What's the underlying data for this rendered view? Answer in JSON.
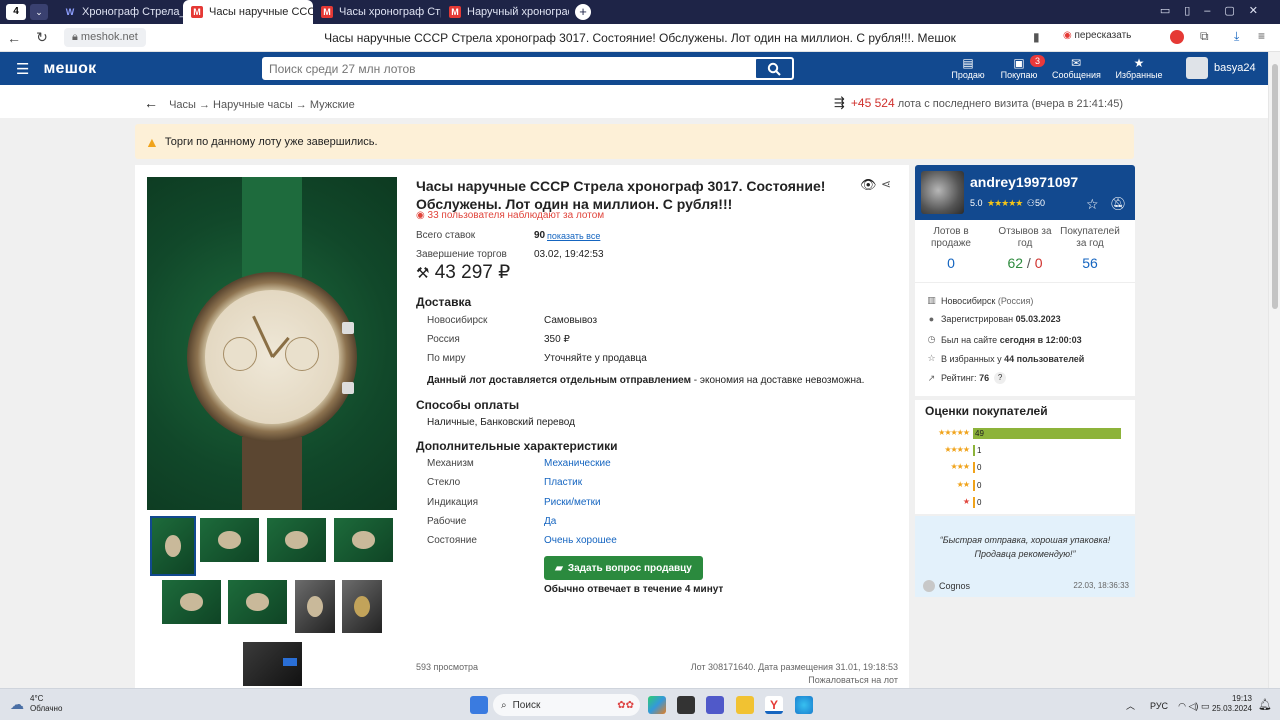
{
  "browser": {
    "tab_counter": "4",
    "tabs": [
      {
        "label": "Хронограф Стрела_ оцен",
        "favicon": "W"
      },
      {
        "label": "Часы наручные СССР С",
        "favicon": "M"
      },
      {
        "label": "Часы хронограф Стрела",
        "favicon": "M"
      },
      {
        "label": "Наручный хронограф - С",
        "favicon": "M"
      }
    ],
    "url": "meshok.net",
    "page_title": "Часы наручные СССР Стрела хронограф 3017. Состояние! Обслужены. Лот один на миллион. С рубля!!!. Мешок",
    "retell_label": "пересказать"
  },
  "site": {
    "logo": "мешок",
    "search_placeholder": "Поиск среди 27 млн лотов",
    "nav": [
      {
        "label": "Продаю",
        "icon": "store-icon"
      },
      {
        "label": "Покупаю",
        "icon": "bag-icon",
        "badge": "3"
      },
      {
        "label": "Сообщения",
        "icon": "mail-icon"
      },
      {
        "label": "Избранные",
        "icon": "star-icon"
      }
    ],
    "username": "basya24"
  },
  "breadcrumb": {
    "path": "Часы → Наручные часы → Мужские",
    "new_count": "+45 524",
    "new_text": "лота с последнего визита (вчера в 21:41:45)"
  },
  "warning": "Торги по данному лоту уже завершились.",
  "lot": {
    "title": "Часы наручные СССР Стрела хронограф 3017. Состояние! Обслужены. Лот один на миллион. С рубля!!!",
    "watchers": "33 пользователя наблюдают за лотом",
    "bids_label": "Всего ставок",
    "bids_value": "90",
    "bids_link": "показать все",
    "end_label": "Завершение торгов",
    "end_value": "03.02, 19:42:53",
    "price": "43 297 ₽",
    "delivery_title": "Доставка",
    "delivery": [
      {
        "where": "Новосибирск",
        "value": "Самовывоз"
      },
      {
        "where": "Россия",
        "value": "350 ₽"
      },
      {
        "where": "По миру",
        "value": "Уточняйте у продавца"
      }
    ],
    "delivery_note_bold": "Данный лот доставляется отдельным отправлением",
    "delivery_note_rest": " - экономия на доставке невозможна.",
    "payment_title": "Способы оплаты",
    "payment": "Наличные, Банковский перевод",
    "extra_title": "Дополнительные характеристики",
    "extra": [
      {
        "key": "Механизм",
        "value": "Механические"
      },
      {
        "key": "Стекло",
        "value": "Пластик"
      },
      {
        "key": "Индикация",
        "value": "Риски/метки"
      },
      {
        "key": "Рабочие",
        "value": "Да"
      },
      {
        "key": "Состояние",
        "value": "Очень хорошее"
      }
    ],
    "ask_button": "Задать вопрос продавцу",
    "reply_time": "Обычно отвечает в течение 4 минут",
    "views": "593 просмотра",
    "lot_info": "Лот 308171640. Дата размещения 31.01, 19:18:53",
    "complain": "Пожаловаться на лот"
  },
  "seller": {
    "name": "andrey19971097",
    "rating": "5.0",
    "stars": "★★★★★",
    "followers": "50",
    "stats": [
      {
        "label": "Лотов в продаже",
        "value": "0"
      },
      {
        "label": "Отзывов за год",
        "pos": "62",
        "sep": " / ",
        "neg": "0"
      },
      {
        "label": "Покупателей за год",
        "value": "56"
      }
    ],
    "city": "Новосибирск",
    "region": "(Россия)",
    "registered_label": "Зарегистрирован",
    "registered": "05.03.2023",
    "online_label": "Был на сайте",
    "online": "сегодня в 12:00:03",
    "fav_label": "В избранных у",
    "fav": "44 пользователей",
    "rating_label": "Рейтинг:",
    "rating_value": "76",
    "help": "?"
  },
  "reviews": {
    "title": "Оценки покупателей",
    "rows": [
      {
        "stars": "★★★★★",
        "count": "49",
        "fraction": 1.0
      },
      {
        "stars": "★★★★",
        "count": "1",
        "fraction": 0
      },
      {
        "stars": "★★★",
        "count": "0",
        "fraction": 0
      },
      {
        "stars": "★★",
        "count": "0",
        "fraction": 0
      },
      {
        "stars": "★",
        "count": "0",
        "fraction": 0
      }
    ],
    "quote": "“Быстрая отправка, хорошая упаковка! Продавца рекомендую!”",
    "author": "Cognos",
    "date": "22.03, 18:36:33"
  },
  "taskbar": {
    "temp": "4°C",
    "weather": "Облачно",
    "search": "Поиск",
    "lang": "РУС",
    "time": "19:13",
    "date": "25.03.2024"
  },
  "colors": {
    "brand": "#12498f",
    "accent_red": "#e0453c",
    "green_button": "#2b8a3e",
    "warning_bg": "#fdf0d7"
  }
}
